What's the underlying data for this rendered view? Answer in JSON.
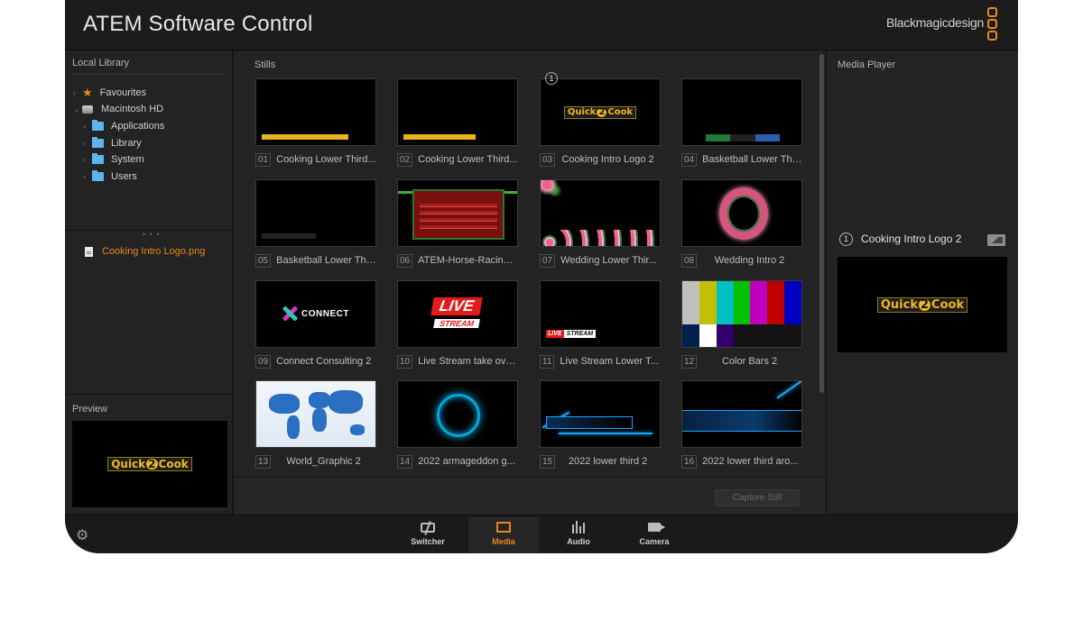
{
  "window": {
    "title": "ATEM Software Control",
    "brand": "Blackmagicdesign"
  },
  "left_panel": {
    "library_title": "Local Library",
    "tree": [
      {
        "label": "Favourites",
        "icon": "star-icon"
      },
      {
        "label": "Macintosh HD",
        "icon": "hard-drive-icon"
      },
      {
        "label": "Applications",
        "icon": "folder-icon"
      },
      {
        "label": "Library",
        "icon": "folder-icon"
      },
      {
        "label": "System",
        "icon": "folder-icon"
      },
      {
        "label": "Users",
        "icon": "folder-icon"
      }
    ],
    "selected_file": "Cooking Intro Logo.png",
    "preview_title": "Preview"
  },
  "logo_text": {
    "left": "Quick",
    "mid": "2",
    "right": "Cook"
  },
  "stills": {
    "title": "Stills",
    "badge": "1",
    "items": [
      {
        "num": "01",
        "name": "Cooking Lower Third..."
      },
      {
        "num": "02",
        "name": "Cooking Lower Third..."
      },
      {
        "num": "03",
        "name": "Cooking Intro Logo 2"
      },
      {
        "num": "04",
        "name": "Basketball Lower Thi..."
      },
      {
        "num": "05",
        "name": "Basketball Lower Thi..."
      },
      {
        "num": "06",
        "name": "ATEM-Horse-Racing-..."
      },
      {
        "num": "07",
        "name": "Wedding Lower Thir..."
      },
      {
        "num": "08",
        "name": "Wedding Intro 2"
      },
      {
        "num": "09",
        "name": "Connect Consulting 2"
      },
      {
        "num": "10",
        "name": "Live Stream take ove..."
      },
      {
        "num": "11",
        "name": "Live Stream Lower T..."
      },
      {
        "num": "12",
        "name": "Color Bars 2"
      },
      {
        "num": "13",
        "name": "World_Graphic 2"
      },
      {
        "num": "14",
        "name": "2022 armageddon g..."
      },
      {
        "num": "15",
        "name": "2022 lower third 2"
      },
      {
        "num": "16",
        "name": "2022 lower third aro..."
      }
    ],
    "capture_label": "Capture Still"
  },
  "media_player": {
    "title": "Media Player",
    "slot": "1",
    "still_name": "Cooking Intro Logo 2"
  },
  "bottom_tabs": {
    "switcher": "Switcher",
    "media": "Media",
    "audio": "Audio",
    "camera": "Camera",
    "active": "Media"
  },
  "colors": {
    "accent": "#e8881c",
    "background": "#1c1c1c",
    "panel": "#232323",
    "folder": "#5fb4ef"
  }
}
